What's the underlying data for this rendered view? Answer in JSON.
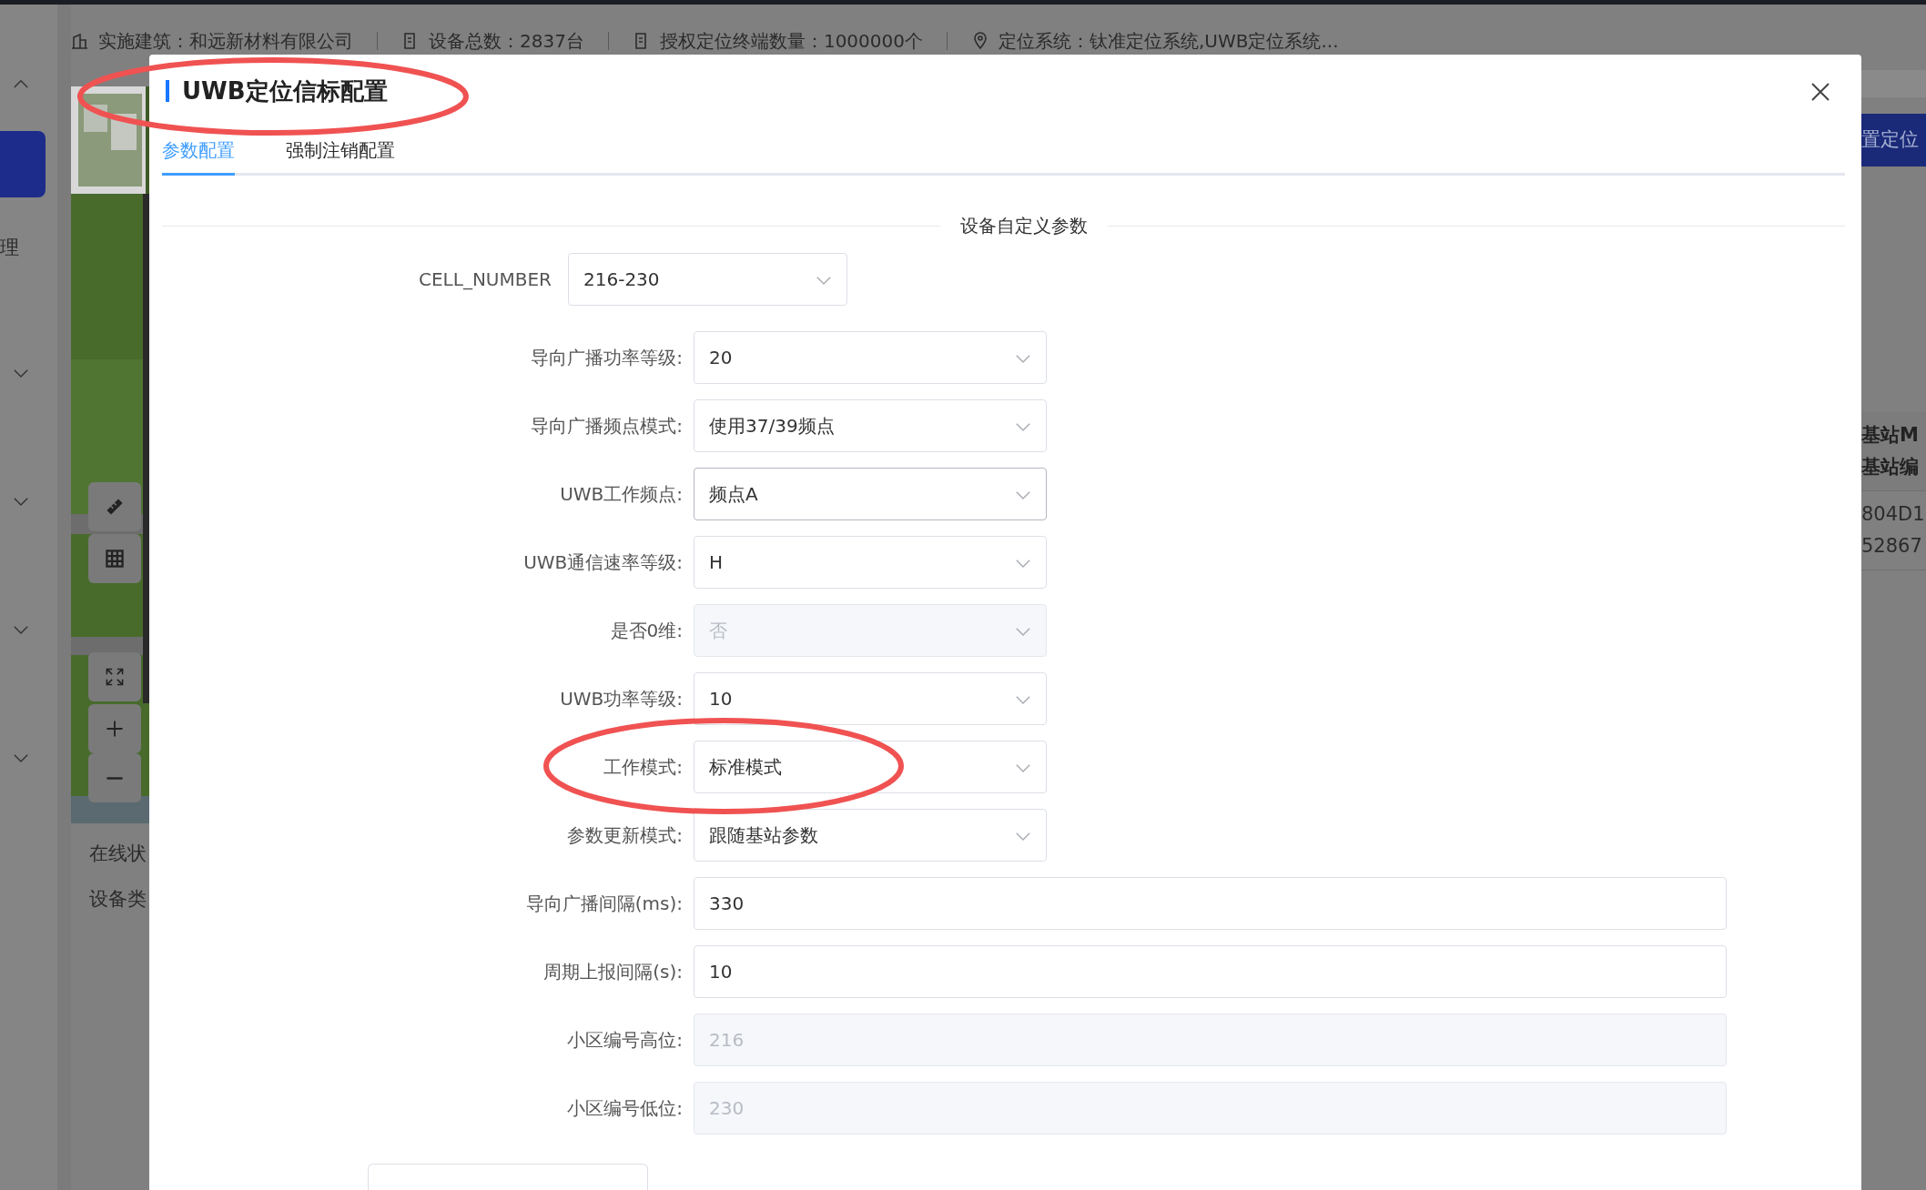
{
  "sidebar": {
    "items": [
      {
        "kind": "group",
        "expanded": true
      },
      {
        "kind": "active",
        "selected": true
      },
      {
        "kind": "text",
        "label": "理"
      },
      {
        "kind": "group",
        "expanded": false
      },
      {
        "kind": "group",
        "expanded": false
      },
      {
        "kind": "group",
        "expanded": false
      },
      {
        "kind": "group",
        "expanded": false
      }
    ]
  },
  "topbar": {
    "items": [
      {
        "kind": "building",
        "text": "实施建筑：和远新材料有限公司"
      },
      {
        "kind": "device",
        "text": "设备总数：2837台"
      },
      {
        "kind": "device",
        "text": "授权定位终端数量：1000000个"
      },
      {
        "kind": "location",
        "text": "定位系统：钛准定位系统,UWB定位系统..."
      }
    ]
  },
  "details": [
    "在线状",
    "设备类"
  ],
  "right_panel": {
    "button": "置定位",
    "header": [
      "基站M",
      "基站编"
    ],
    "cells": [
      "804D1",
      "52867"
    ]
  },
  "modal": {
    "title": "UWB定位信标配置",
    "tabs": [
      {
        "label": "参数配置",
        "selected": true
      },
      {
        "label": "强制注销配置",
        "selected": false
      }
    ],
    "section_title": "设备自定义参数",
    "cell_number": {
      "label": "CELL_NUMBER",
      "value": "216-230"
    },
    "fields": [
      {
        "kind": "select",
        "label": "导向广播功率等级:",
        "value": "20",
        "disabled": false,
        "hovered": false
      },
      {
        "kind": "select",
        "label": "导向广播频点模式:",
        "value": "使用37/39频点",
        "disabled": false,
        "hovered": false
      },
      {
        "kind": "select",
        "label": "UWB工作频点:",
        "value": "频点A",
        "disabled": false,
        "hovered": true
      },
      {
        "kind": "select",
        "label": "UWB通信速率等级:",
        "value": "H",
        "disabled": false,
        "hovered": false
      },
      {
        "kind": "select",
        "label": "是否0维:",
        "value": "否",
        "disabled": true,
        "hovered": false
      },
      {
        "kind": "select",
        "label": "UWB功率等级:",
        "value": "10",
        "disabled": false,
        "hovered": false
      },
      {
        "kind": "select",
        "label": "工作模式:",
        "value": "标准模式",
        "disabled": false,
        "hovered": false
      },
      {
        "kind": "select",
        "label": "参数更新模式:",
        "value": "跟随基站参数",
        "disabled": false,
        "hovered": false
      },
      {
        "kind": "input",
        "label": "导向广播间隔(ms):",
        "value": "330",
        "disabled": false,
        "hovered": false
      },
      {
        "kind": "input",
        "label": "周期上报间隔(s):",
        "value": "10",
        "disabled": false,
        "hovered": false
      },
      {
        "kind": "input",
        "label": "小区编号高位:",
        "value": "216",
        "disabled": true,
        "hovered": false
      },
      {
        "kind": "input",
        "label": "小区编号低位:",
        "value": "230",
        "disabled": true,
        "hovered": false
      }
    ]
  },
  "markup": [
    {
      "kind": "ellipse"
    },
    {
      "kind": "ellipse"
    }
  ]
}
